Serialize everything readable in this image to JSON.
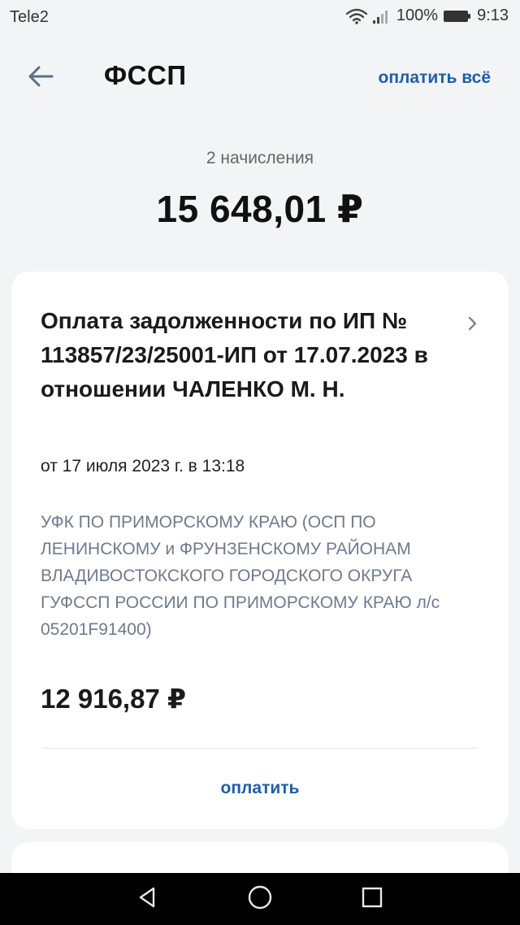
{
  "status_bar": {
    "carrier": "Tele2",
    "battery": "100%",
    "time": "9:13"
  },
  "header": {
    "title": "ФССП",
    "action_label": "оплатить всё"
  },
  "summary": {
    "count_label": "2 начисления",
    "total": "15 648,01 ₽"
  },
  "charges": [
    {
      "title": "Оплата задолженности по ИП № 113857/23/25001-ИП от 17.07.2023 в отношении ЧАЛЕНКО М. Н.",
      "date": "от 17 июля 2023 г. в 13:18",
      "recipient": "УФК ПО ПРИМОРСКОМУ КРАЮ (ОСП ПО ЛЕНИНСКОМУ и ФРУНЗЕНСКОМУ РАЙОНАМ ВЛАДИВОСТОКСКОГО ГОРОДСКОГО ОКРУГА ГУФССП РОССИИ ПО ПРИМОРСКОМУ КРАЮ л/с 05201F91400)",
      "amount": "12 916,87 ₽",
      "pay_label": "оплатить"
    }
  ],
  "icons": {
    "back": "arrow-left-icon",
    "chevron": "chevron-right-icon",
    "wifi": "wifi-icon",
    "signal": "signal-icon",
    "battery": "battery-icon",
    "nav_back": "triangle-back-icon",
    "nav_home": "circle-home-icon",
    "nav_recents": "square-recents-icon"
  },
  "colors": {
    "accent": "#1e5ea8",
    "background": "#f3f4f6",
    "card": "#ffffff",
    "secondary_text": "#707a8c"
  }
}
